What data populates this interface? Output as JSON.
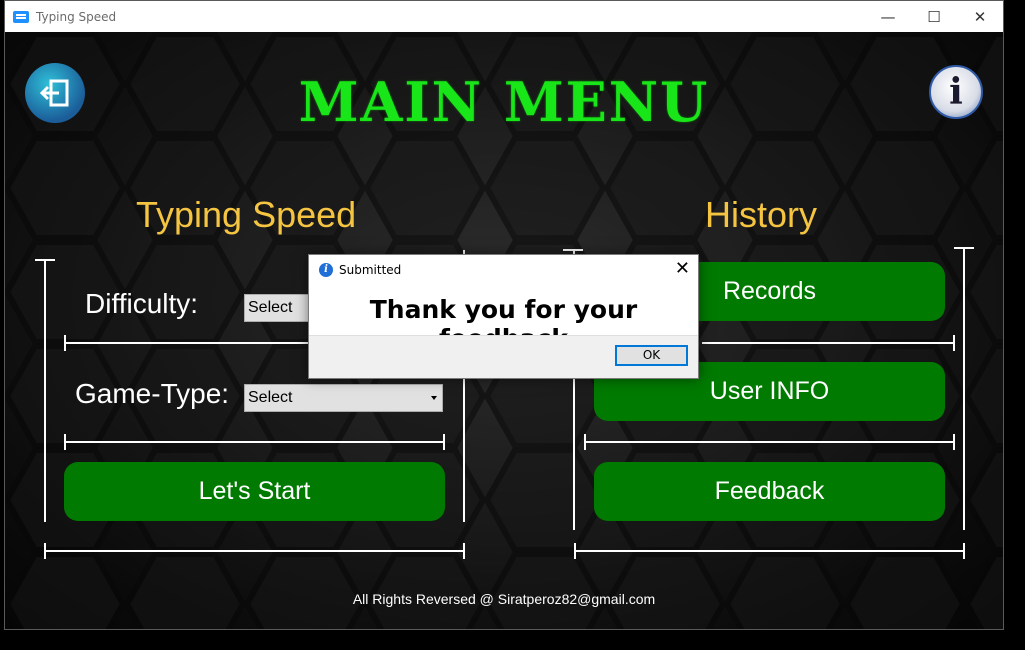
{
  "window": {
    "title": "Typing Speed",
    "controls": [
      "—",
      "☐",
      "✕"
    ]
  },
  "menu": {
    "title": "MAIN MENU",
    "left_section": "Typing Speed",
    "right_section": "History",
    "difficulty_label": "Difficulty:",
    "difficulty_value": "Select",
    "game_type_label": "Game-Type:",
    "game_type_value": "Select",
    "start_button": "Let's Start",
    "records_button": "Records",
    "user_info_button": "User INFO",
    "feedback_button": "Feedback",
    "footer": "All Rights Reversed @ Siratperoz82@gmail.com"
  },
  "dialog": {
    "title": "Submitted",
    "message": "Thank you for your feedback",
    "ok_button": "OK"
  },
  "icons": {
    "logout": "logout-icon",
    "info": "info-icon",
    "dialog_info": "info-icon"
  },
  "colors": {
    "title_green": "#19e619",
    "section_gold": "#f5c542",
    "button_green": "#017a01"
  }
}
